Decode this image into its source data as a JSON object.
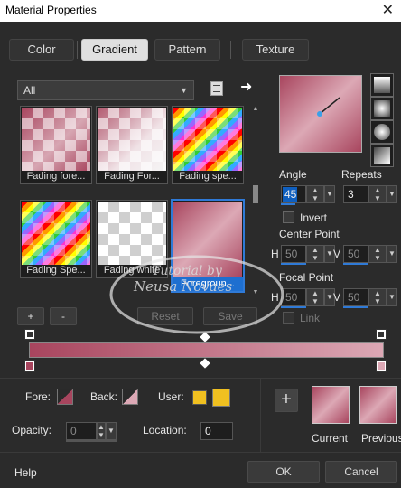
{
  "window": {
    "title": "Material Properties",
    "close_glyph": "✕"
  },
  "tabs": [
    {
      "label": "Color"
    },
    {
      "label": "Gradient"
    },
    {
      "label": "Pattern"
    },
    {
      "label": "Texture"
    }
  ],
  "category": {
    "value": "All"
  },
  "thumbnails": [
    {
      "label": "Fading fore..."
    },
    {
      "label": "Fading For..."
    },
    {
      "label": "Fading spe..."
    },
    {
      "label": "Fading Spe..."
    },
    {
      "label": "Fading white"
    },
    {
      "label": "Foregroun..."
    }
  ],
  "list_buttons": {
    "add": "+",
    "remove": "-",
    "reset": "Reset",
    "save": "Save"
  },
  "angle": {
    "label": "Angle",
    "value": "45"
  },
  "repeats": {
    "label": "Repeats",
    "value": "3"
  },
  "invert": {
    "label": "Invert"
  },
  "center_point": {
    "label": "Center Point",
    "h_label": "H",
    "h_value": "50",
    "v_label": "V",
    "v_value": "50"
  },
  "focal_point": {
    "label": "Focal Point",
    "h_label": "H",
    "h_value": "50",
    "v_label": "V",
    "v_value": "50"
  },
  "link": {
    "label": "Link"
  },
  "watermark": {
    "line1": "Tutorial by",
    "line2": "Neusa Novaes"
  },
  "fore": {
    "label": "Fore:"
  },
  "back": {
    "label": "Back:"
  },
  "user": {
    "label": "User:",
    "color": "#f0c020"
  },
  "opacity": {
    "label": "Opacity:",
    "value": "0"
  },
  "location": {
    "label": "Location:",
    "value": "0"
  },
  "current": {
    "label": "Current"
  },
  "previous": {
    "label": "Previous"
  },
  "footer": {
    "help": "Help",
    "ok": "OK",
    "cancel": "Cancel"
  },
  "colors": {
    "gradient_dark": "#a8455e",
    "gradient_light": "#dca8b5",
    "accent": "#2f7ad7"
  }
}
